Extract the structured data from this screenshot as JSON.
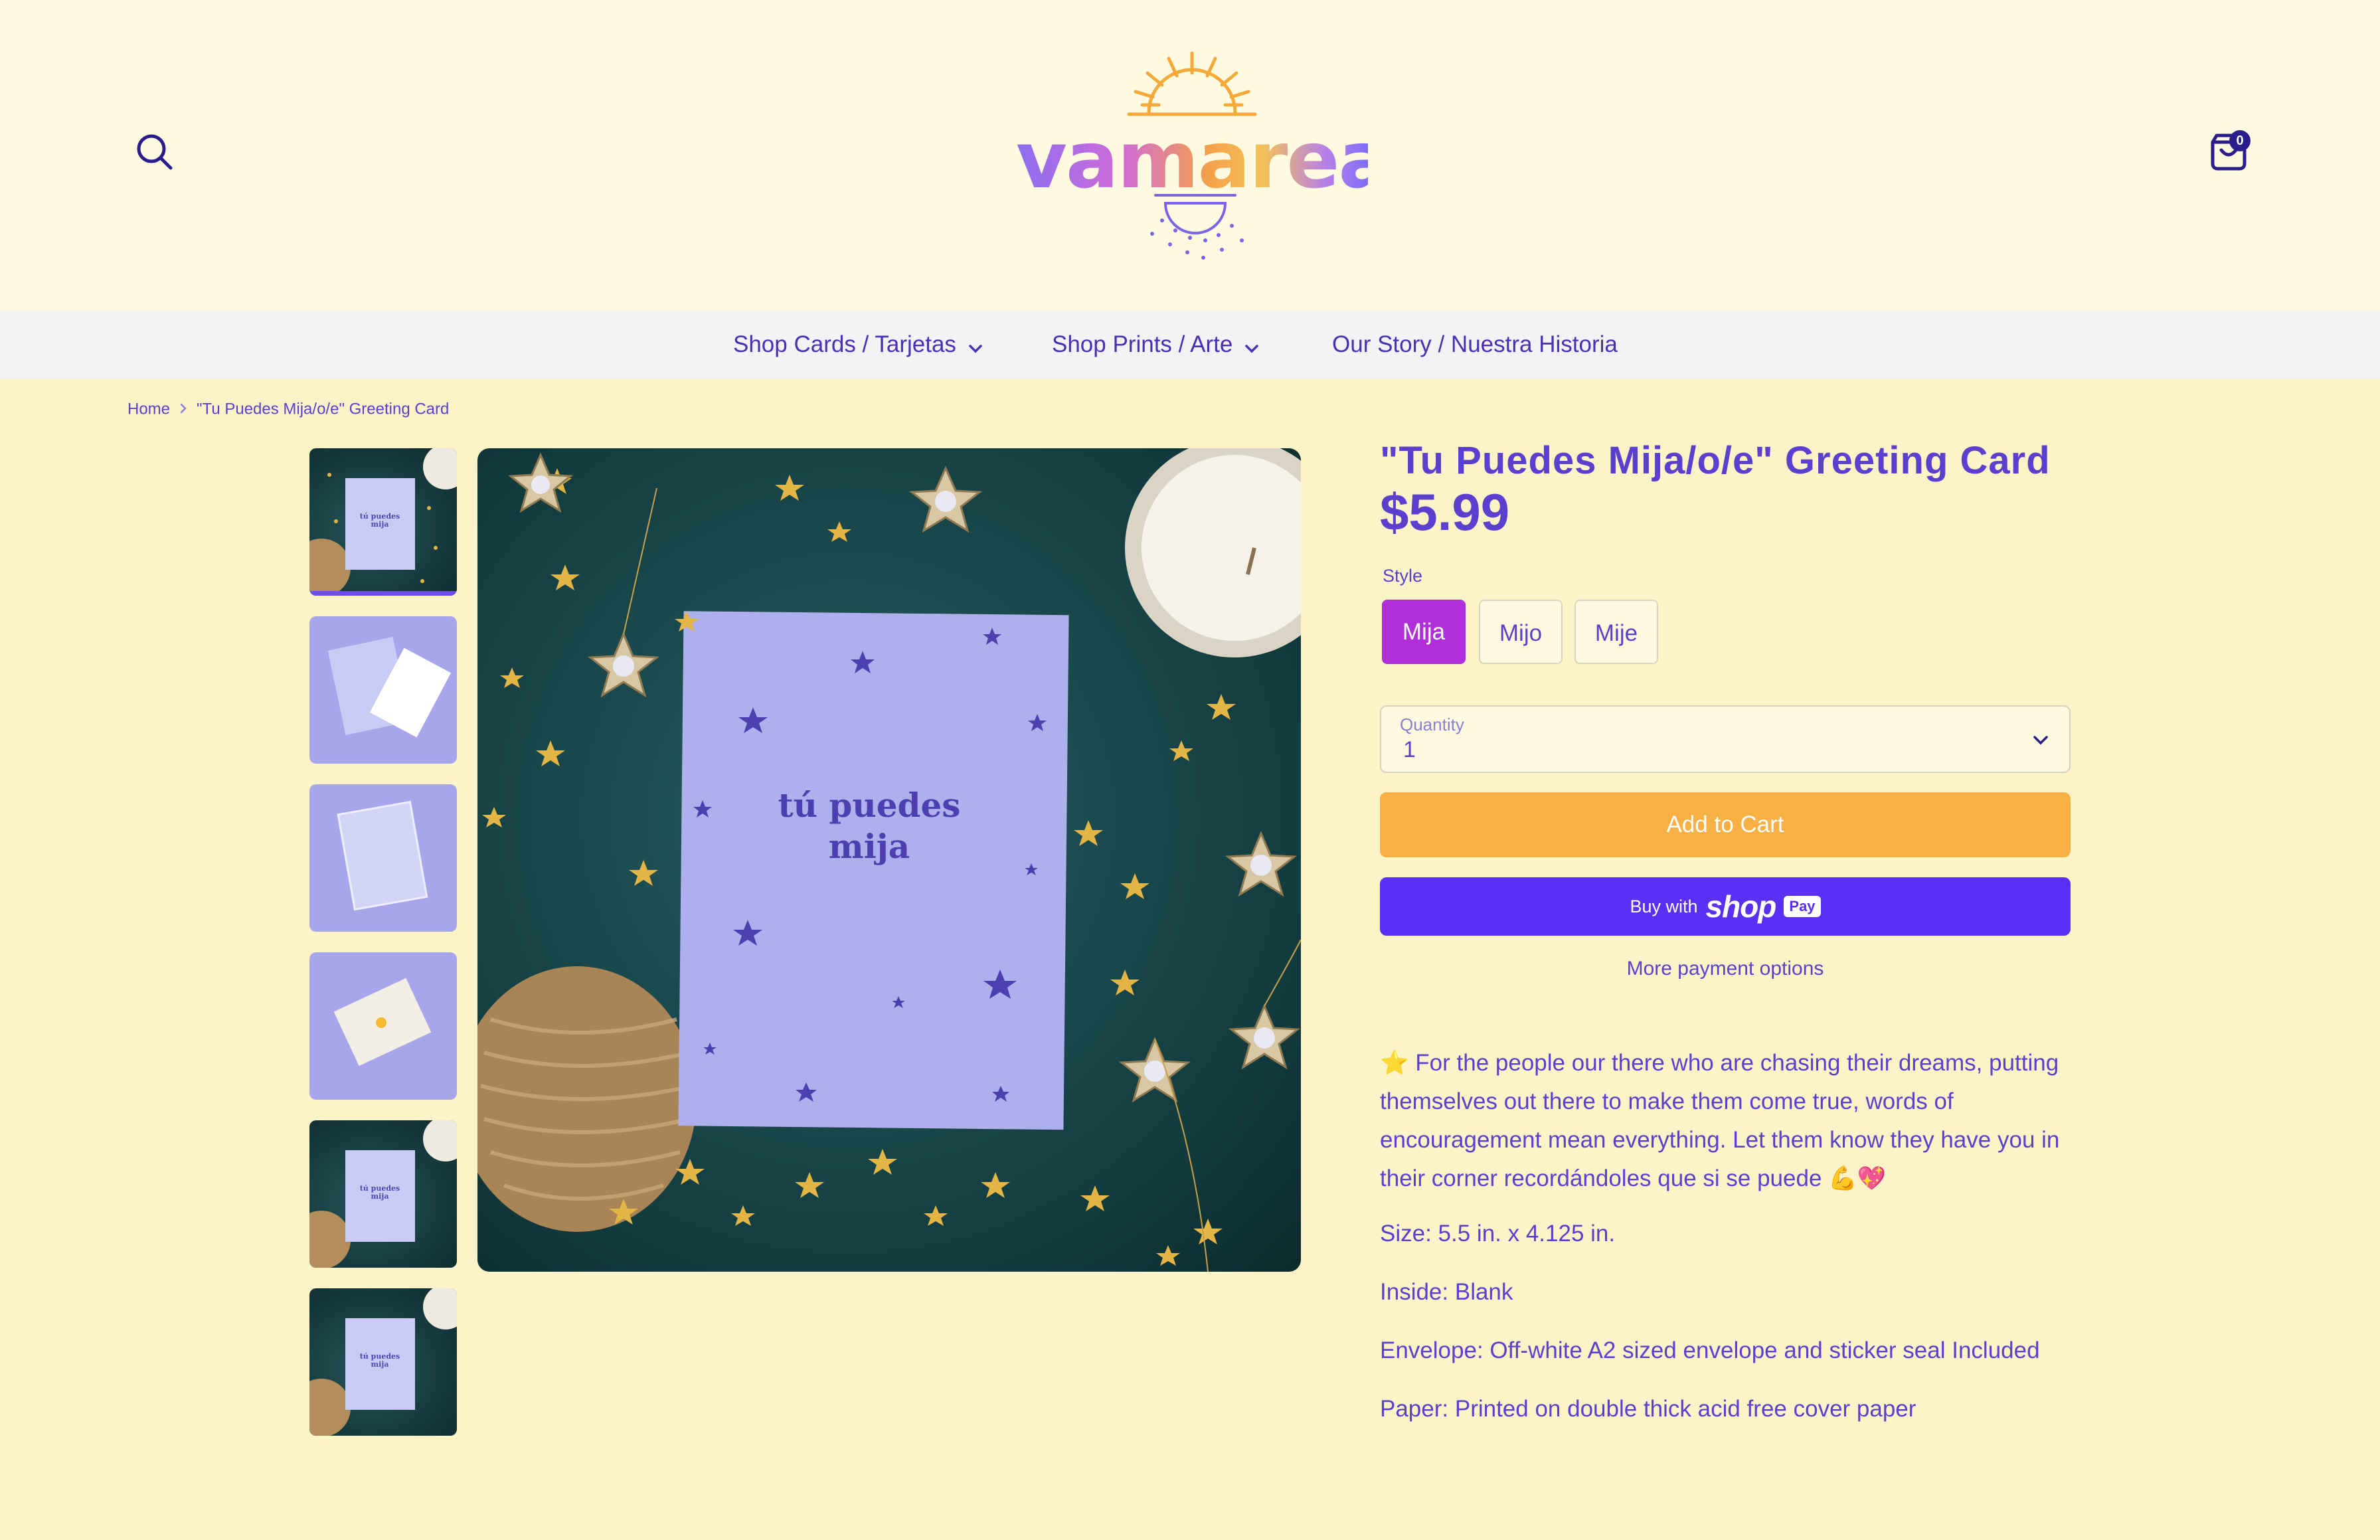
{
  "header": {
    "brand": "vamarea",
    "cart_count": "0"
  },
  "nav": {
    "items": [
      {
        "label": "Shop Cards / Tarjetas",
        "has_dropdown": true
      },
      {
        "label": "Shop Prints / Arte",
        "has_dropdown": true
      },
      {
        "label": "Our Story / Nuestra Historia",
        "has_dropdown": false
      }
    ]
  },
  "breadcrumb": {
    "home": "Home",
    "current": "\"Tu Puedes Mija/o/e\" Greeting Card"
  },
  "gallery": {
    "card_text": [
      "tú puedes",
      "mija"
    ],
    "thumb_card_text": "tú puedes mija",
    "selected_thumbnail": 1,
    "thumbnail_count": 6
  },
  "product": {
    "title": "\"Tu Puedes Mija/o/e\" Greeting Card",
    "price": "$5.99",
    "style_label": "Style",
    "styles": [
      "Mija",
      "Mijo",
      "Mije"
    ],
    "selected_style": "Mija",
    "quantity_label": "Quantity",
    "quantity_value": "1",
    "add_to_cart": "Add to Cart",
    "buy_with": "Buy with",
    "shop_brand": "shop",
    "pay_badge": "Pay",
    "more_payment": "More payment options",
    "description": "⭐ For the people our there who are chasing their dreams, putting themselves out there to make them come true, words of encouragement mean everything. Let them know they have you in their corner recordándoles que si se puede 💪💖",
    "size": "Size: 5.5 in. x 4.125 in.",
    "inside": "Inside: Blank",
    "envelope": "Envelope: Off-white A2 sized envelope and sticker seal Included",
    "paper": "Paper: Printed on double thick acid free cover paper"
  },
  "colors": {
    "accent": "#5b3fcf",
    "header_bg": "#fffbe0",
    "page_bg": "#fdf3c8",
    "selected_style": "#b12fd9",
    "add_to_cart": "#f8b045",
    "shop_pay": "#5a31f4"
  }
}
